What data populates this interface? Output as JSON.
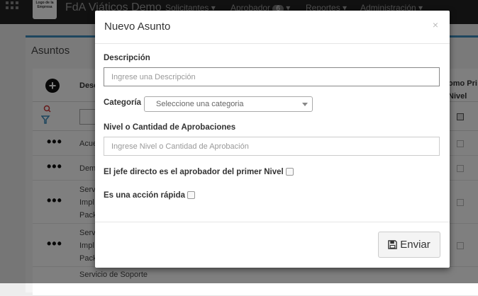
{
  "navbar": {
    "logo_text": "Logo de la Empresa",
    "brand": "FdA Viáticos Demo",
    "items": [
      {
        "label": "Solicitantes"
      },
      {
        "label": "Aprobador",
        "badge": "6"
      },
      {
        "label": "Reportes"
      },
      {
        "label": "Administración"
      }
    ]
  },
  "page": {
    "title": "Asuntos",
    "header_desc": "Desc",
    "header_right_1": "omo Pri",
    "header_right_2": "Nivel",
    "rows": [
      {
        "lines": [
          "Acue"
        ]
      },
      {
        "lines": [
          "Dem"
        ]
      },
      {
        "lines": [
          "Serv",
          "Impl",
          "Pack"
        ]
      },
      {
        "lines": [
          "Serv",
          "Impl",
          "Pack"
        ]
      },
      {
        "lines": [
          "Servicio de Soporte"
        ]
      }
    ]
  },
  "modal": {
    "title": "Nuevo Asunto",
    "close": "×",
    "descripcion_label": "Descripción",
    "descripcion_placeholder": "Ingrese una Descripción",
    "categoria_label": "Categoría",
    "categoria_selected": "Seleccione una categoria",
    "nivel_label": "Nivel o Cantidad de Aprobaciones",
    "nivel_placeholder": "Ingrese Nivel o Cantidad de Aprobación",
    "jefe_label": "El jefe directo es el aprobador del primer Nivel",
    "accion_label": "Es una acción rápida",
    "submit_label": "Enviar"
  },
  "colors": {
    "accent": "#3c8dbc",
    "navbar": "#222222",
    "overlay": "rgba(0,0,0,0.5)"
  }
}
